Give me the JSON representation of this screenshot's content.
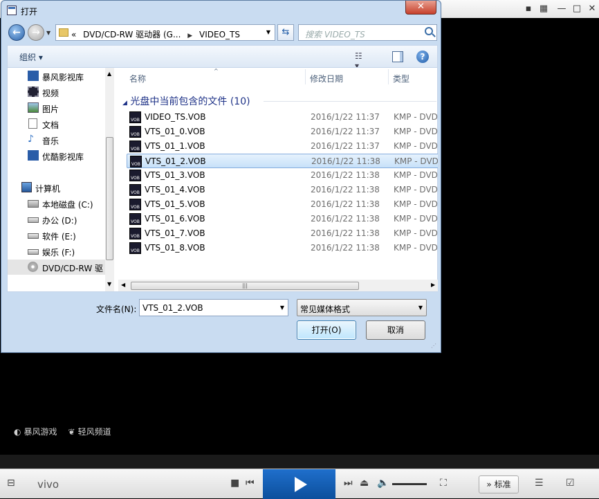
{
  "player": {
    "links": [
      "暴风游戏",
      "轻风频道"
    ],
    "brand": "vivo",
    "standard_label": "标准"
  },
  "dialog": {
    "title": "打开",
    "close_glyph": "✕",
    "address": {
      "prefix": "«",
      "segments": [
        "DVD/CD-RW 驱动器 (G...",
        "VIDEO_TS"
      ]
    },
    "search_placeholder": "搜索 VIDEO_TS",
    "organize_label": "组织 ▾",
    "nav": [
      {
        "label": "暴风影视库",
        "icon": "video-library-icon"
      },
      {
        "label": "视频",
        "icon": "video-icon"
      },
      {
        "label": "图片",
        "icon": "picture-icon"
      },
      {
        "label": "文档",
        "icon": "document-icon"
      },
      {
        "label": "音乐",
        "icon": "music-icon"
      },
      {
        "label": "优酷影视库",
        "icon": "video-library-icon"
      },
      {
        "label": "计算机",
        "icon": "computer-icon"
      },
      {
        "label": "本地磁盘 (C:)",
        "icon": "windows-drive-icon"
      },
      {
        "label": "办公 (D:)",
        "icon": "drive-icon"
      },
      {
        "label": "软件 (E:)",
        "icon": "drive-icon"
      },
      {
        "label": "娱乐 (F:)",
        "icon": "drive-icon"
      },
      {
        "label": "DVD/CD-RW 驱",
        "icon": "disc-icon"
      }
    ],
    "columns": {
      "name": "名称",
      "date": "修改日期",
      "type": "类型"
    },
    "group_header": "光盘中当前包含的文件 (10)",
    "files": [
      {
        "name": "VIDEO_TS.VOB",
        "date": "2016/1/22 11:37",
        "type": "KMP - DVD"
      },
      {
        "name": "VTS_01_0.VOB",
        "date": "2016/1/22 11:37",
        "type": "KMP - DVD"
      },
      {
        "name": "VTS_01_1.VOB",
        "date": "2016/1/22 11:37",
        "type": "KMP - DVD"
      },
      {
        "name": "VTS_01_2.VOB",
        "date": "2016/1/22 11:38",
        "type": "KMP - DVD",
        "selected": true
      },
      {
        "name": "VTS_01_3.VOB",
        "date": "2016/1/22 11:38",
        "type": "KMP - DVD"
      },
      {
        "name": "VTS_01_4.VOB",
        "date": "2016/1/22 11:38",
        "type": "KMP - DVD"
      },
      {
        "name": "VTS_01_5.VOB",
        "date": "2016/1/22 11:38",
        "type": "KMP - DVD"
      },
      {
        "name": "VTS_01_6.VOB",
        "date": "2016/1/22 11:38",
        "type": "KMP - DVD"
      },
      {
        "name": "VTS_01_7.VOB",
        "date": "2016/1/22 11:38",
        "type": "KMP - DVD"
      },
      {
        "name": "VTS_01_8.VOB",
        "date": "2016/1/22 11:38",
        "type": "KMP - DVD"
      }
    ],
    "filename_label": "文件名(N):",
    "filename_value": "VTS_01_2.VOB",
    "filter_value": "常见媒体格式",
    "open_label": "打开(O)",
    "cancel_label": "取消"
  }
}
